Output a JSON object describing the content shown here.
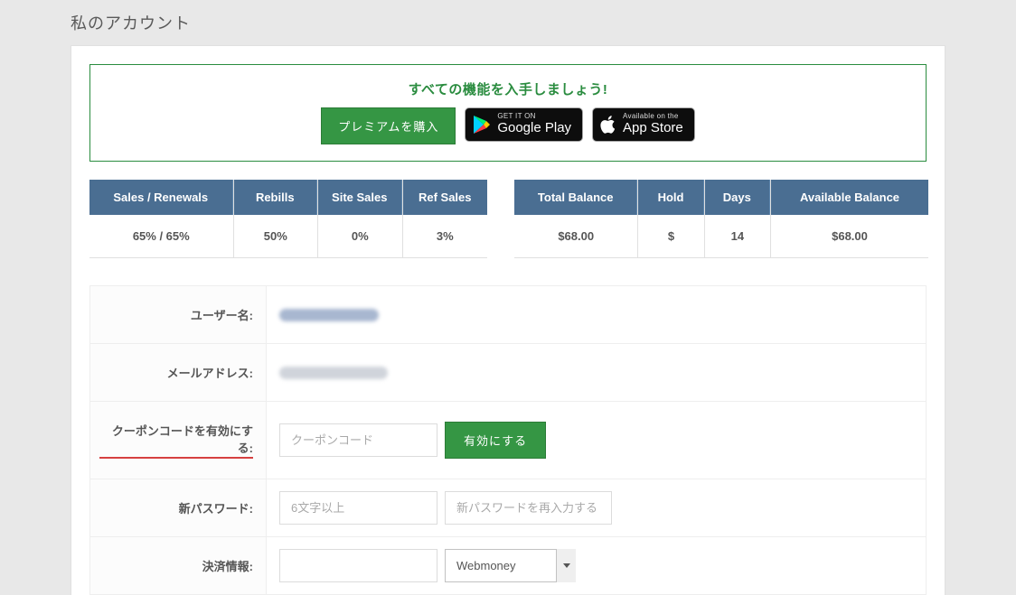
{
  "page": {
    "title": "私のアカウント"
  },
  "promo": {
    "title": "すべての機能を入手しましょう!",
    "buy_premium_label": "プレミアムを購入",
    "gplay_small": "GET IT ON",
    "gplay_big": "Google Play",
    "appstore_small": "Available on the",
    "appstore_big": "App Store"
  },
  "stats_left": {
    "headers": {
      "sales": "Sales / Renewals",
      "rebills": "Rebills",
      "site": "Site Sales",
      "ref": "Ref Sales"
    },
    "values": {
      "sales": "65% / 65%",
      "rebills": "50%",
      "site": "0%",
      "ref": "3%"
    }
  },
  "stats_right": {
    "headers": {
      "total": "Total Balance",
      "hold": "Hold",
      "days": "Days",
      "avail": "Available Balance"
    },
    "values": {
      "total": "$68.00",
      "hold": "$",
      "days": "14",
      "avail": "$68.00"
    }
  },
  "form": {
    "username_label": "ユーザー名:",
    "email_label": "メールアドレス:",
    "coupon_label": "クーポンコードを有効にする:",
    "coupon_placeholder": "クーポンコード",
    "coupon_button": "有効にする",
    "newpw_label": "新パスワード:",
    "newpw_placeholder": "6文字以上",
    "newpw_confirm_placeholder": "新パスワードを再入力する",
    "payment_label": "決済情報:",
    "payment_method_selected": "Webmoney"
  }
}
